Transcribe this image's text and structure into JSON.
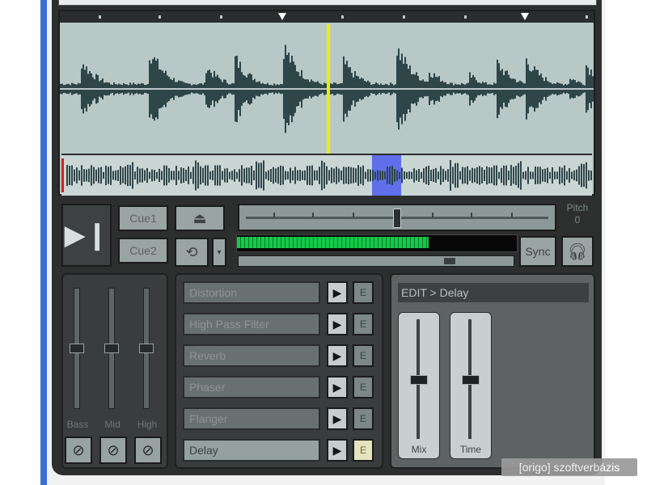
{
  "transport": {
    "play_pause_icon": "play-pause-icon",
    "cue1_label": "Cue1",
    "cue2_label": "Cue2",
    "eject_icon": "eject-icon",
    "loop_icon": "loop-icon",
    "pitch_label": "Pitch",
    "pitch_value": "0",
    "pitch_position": 0.5,
    "level_fraction": 0.69,
    "position_fraction": 0.78,
    "sync_label": "Sync",
    "headphones_icon": "headphones-icon"
  },
  "waveform": {
    "playhead_fraction": 0.5,
    "overview_selection_fraction": 0.57
  },
  "mixer": {
    "channels": [
      {
        "label": "Bass",
        "level": 0.5
      },
      {
        "label": "Mid",
        "level": 0.5
      },
      {
        "label": "High",
        "level": 0.5
      }
    ],
    "kill_icon": "kill-icon"
  },
  "effects": [
    {
      "name": "Distortion",
      "active": false
    },
    {
      "name": "High Pass Filter",
      "active": false
    },
    {
      "name": "Reverb",
      "active": false
    },
    {
      "name": "Phaser",
      "active": false
    },
    {
      "name": "Flanger",
      "active": false
    },
    {
      "name": "Delay",
      "active": true
    }
  ],
  "edit": {
    "title": "EDIT > Delay",
    "sliders": [
      {
        "label": "Mix",
        "level": 0.5
      },
      {
        "label": "Time",
        "level": 0.5
      }
    ]
  },
  "watermark": "[origo] szoftverbázis",
  "colors": {
    "waveform": "#2f4649",
    "waveform_bg": "#b8c8c6",
    "playhead": "#e8f000",
    "level": "#17c84a",
    "selection": "#3a4cf0"
  }
}
